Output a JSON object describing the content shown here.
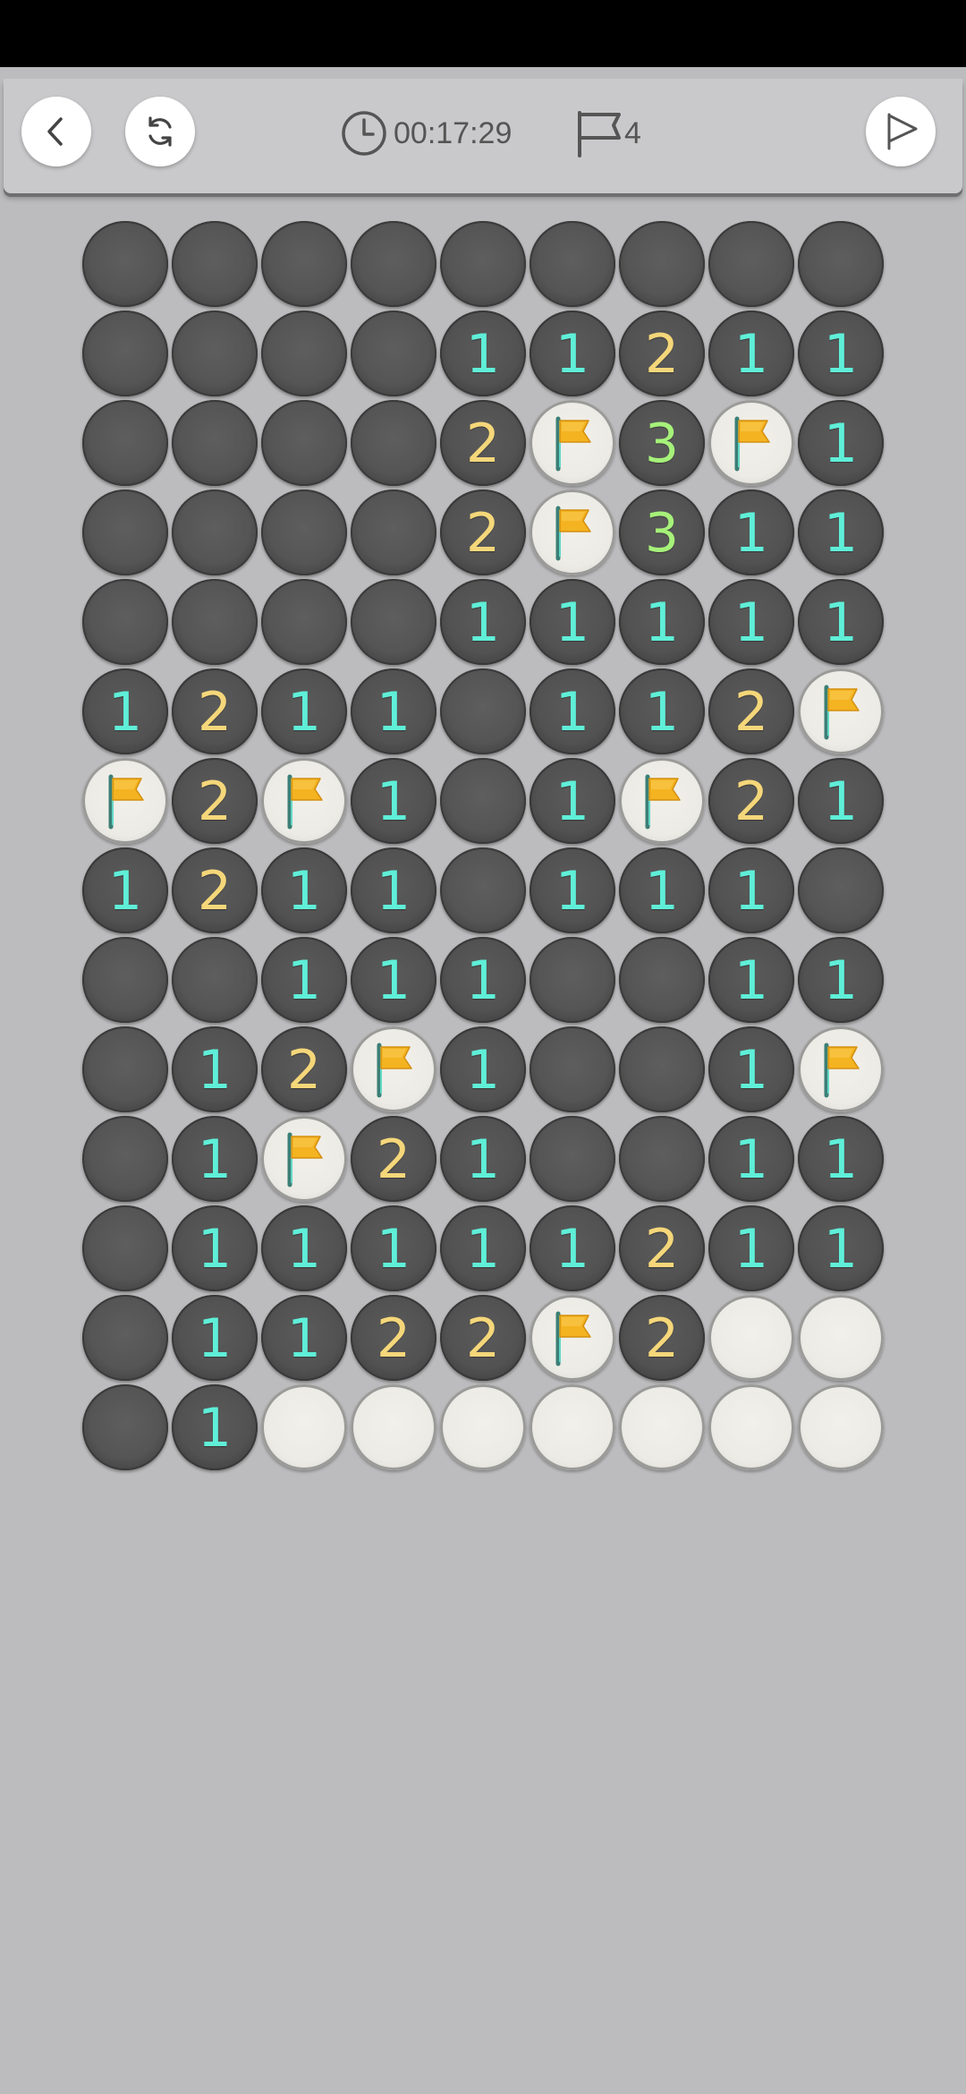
{
  "toolbar": {
    "back_icon": "chevron-left-icon",
    "restart_icon": "refresh-icon",
    "timer_icon": "clock-icon",
    "timer": "00:17:29",
    "flag_icon": "flag-outline-icon",
    "flags_remaining": "4",
    "flag_mode_icon": "flag-play-icon"
  },
  "colors": {
    "number_1": "#5fefd8",
    "number_2": "#f5d77a",
    "number_3": "#a6f17a",
    "flag": "#f4b320",
    "background": "#bcbcbe"
  },
  "legend": {
    "H": "hidden",
    "F": "flag",
    "O": "opened-empty",
    "digit": "revealed number"
  },
  "board": {
    "cols": 9,
    "rows": [
      [
        "H",
        "H",
        "H",
        "H",
        "H",
        "H",
        "H",
        "H",
        "H"
      ],
      [
        "H",
        "H",
        "H",
        "H",
        "1",
        "1",
        "2",
        "1",
        "1"
      ],
      [
        "H",
        "H",
        "H",
        "H",
        "2",
        "F",
        "3",
        "F",
        "1"
      ],
      [
        "H",
        "H",
        "H",
        "H",
        "2",
        "F",
        "3",
        "1",
        "1"
      ],
      [
        "H",
        "H",
        "H",
        "H",
        "1",
        "1",
        "1",
        "1",
        "1"
      ],
      [
        "1",
        "2",
        "1",
        "1",
        "H",
        "1",
        "1",
        "2",
        "F"
      ],
      [
        "F",
        "2",
        "F",
        "1",
        "H",
        "1",
        "F",
        "2",
        "1"
      ],
      [
        "1",
        "2",
        "1",
        "1",
        "H",
        "1",
        "1",
        "1",
        "H"
      ],
      [
        "H",
        "H",
        "1",
        "1",
        "1",
        "H",
        "H",
        "1",
        "1"
      ],
      [
        "H",
        "1",
        "2",
        "F",
        "1",
        "H",
        "H",
        "1",
        "F"
      ],
      [
        "H",
        "1",
        "F",
        "2",
        "1",
        "H",
        "H",
        "1",
        "1"
      ],
      [
        "H",
        "1",
        "1",
        "1",
        "1",
        "1",
        "2",
        "1",
        "1"
      ],
      [
        "H",
        "1",
        "1",
        "2",
        "2",
        "F",
        "2",
        "O",
        "O"
      ],
      [
        "H",
        "1",
        "O",
        "O",
        "O",
        "O",
        "O",
        "O",
        "O"
      ]
    ]
  }
}
